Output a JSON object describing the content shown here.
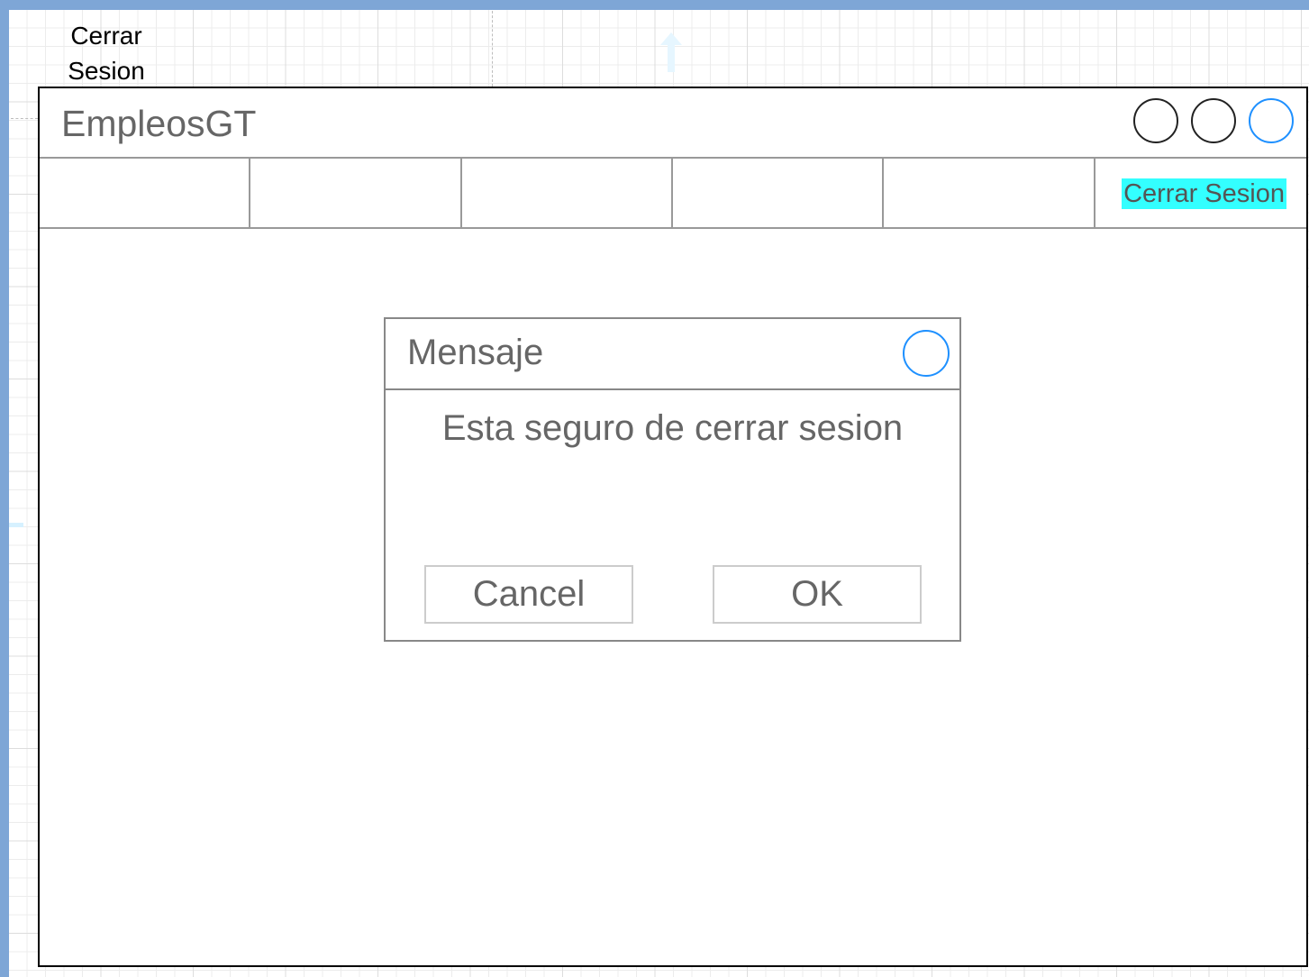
{
  "canvas": {
    "shape_label": "Cerrar\nSesion"
  },
  "window": {
    "app_title": "EmpleosGT",
    "controls": [
      "circle-icon",
      "circle-icon",
      "circle-icon"
    ]
  },
  "navbar": {
    "tabs": [
      {
        "label": ""
      },
      {
        "label": ""
      },
      {
        "label": ""
      },
      {
        "label": ""
      },
      {
        "label": ""
      },
      {
        "label": "Cerrar Sesion"
      }
    ],
    "highlight_color": "#33ffff"
  },
  "dialog": {
    "title": "Mensaje",
    "message": "Esta seguro de cerrar sesion",
    "cancel_label": "Cancel",
    "ok_label": "OK"
  },
  "colors": {
    "accent_blue": "#1e90ff",
    "frame_blue": "#7ea6d6",
    "text_gray": "#666666"
  }
}
